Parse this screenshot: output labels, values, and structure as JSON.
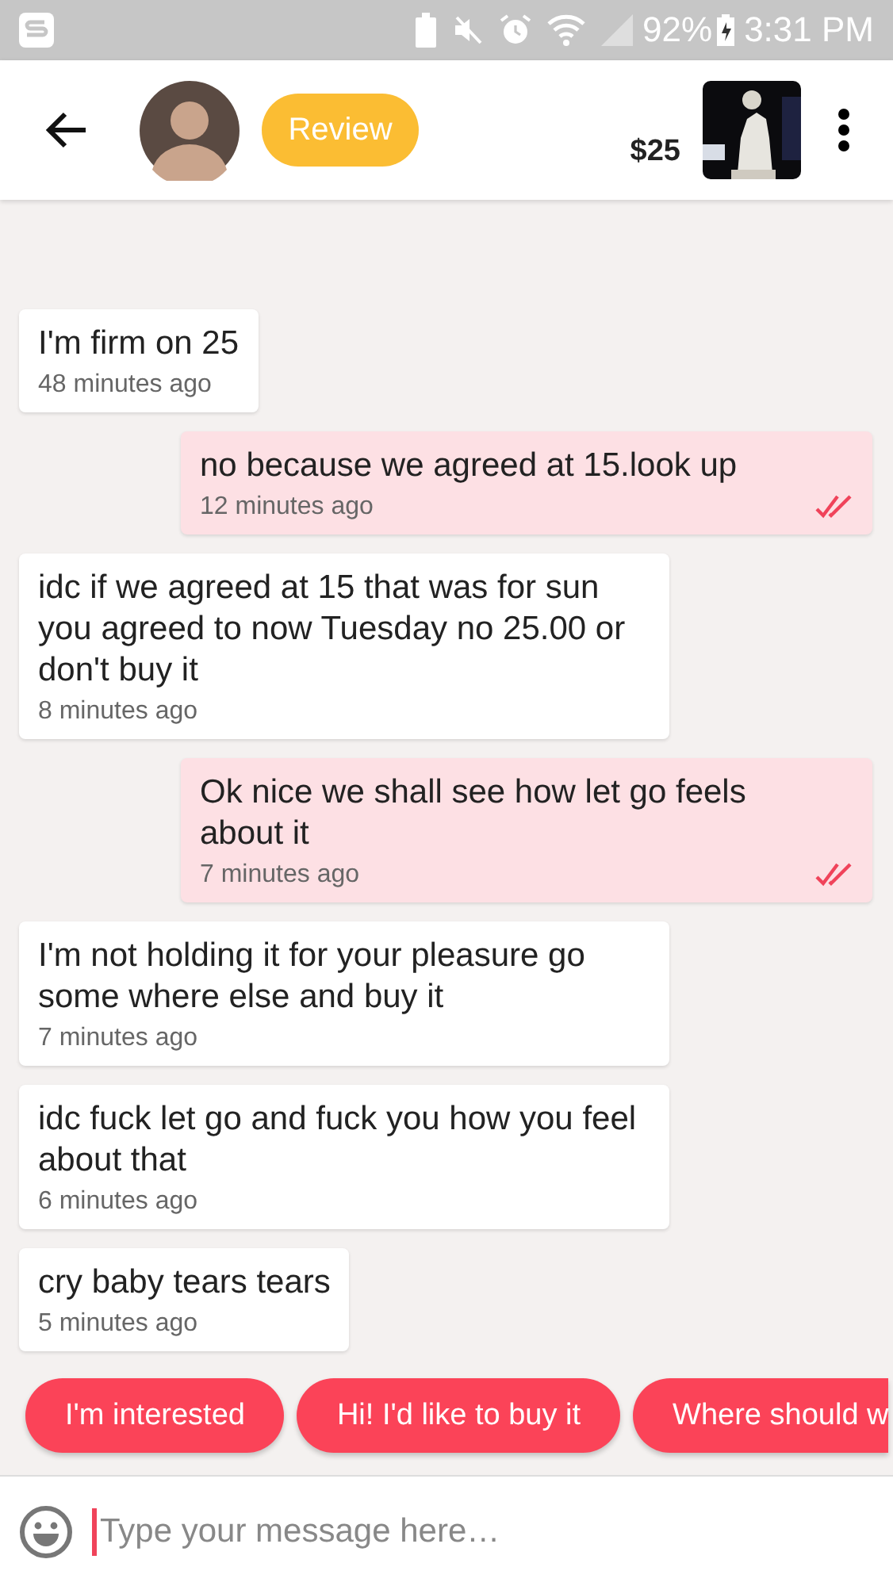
{
  "status_bar": {
    "battery": "92%",
    "time": "3:31 PM"
  },
  "header": {
    "review_button": "Review",
    "price": "$25"
  },
  "messages": [
    {
      "kind": "received",
      "text": "I'm firm on 25",
      "time": "48 minutes ago"
    },
    {
      "kind": "sent",
      "text": "no because we agreed at 15.look up",
      "time": "12 minutes ago",
      "read": true
    },
    {
      "kind": "received",
      "text": "idc if we agreed at 15 that was for sun you agreed to now Tuesday no 25.00 or don't buy it",
      "time": "8 minutes ago"
    },
    {
      "kind": "sent",
      "text": "Ok nice we shall see how let go feels about it",
      "time": "7 minutes ago",
      "read": true
    },
    {
      "kind": "received",
      "text": "I'm not holding it for your pleasure go some where else and buy it",
      "time": "7 minutes ago"
    },
    {
      "kind": "received",
      "text": "idc fuck let go and fuck you how you feel about that",
      "time": "6 minutes ago"
    },
    {
      "kind": "received",
      "text": "cry baby tears tears",
      "time": "5 minutes ago"
    }
  ],
  "quick_replies": [
    "I'm interested",
    "Hi! I'd like to buy it",
    "Where should w"
  ],
  "composer": {
    "placeholder": "Type your message here…"
  }
}
